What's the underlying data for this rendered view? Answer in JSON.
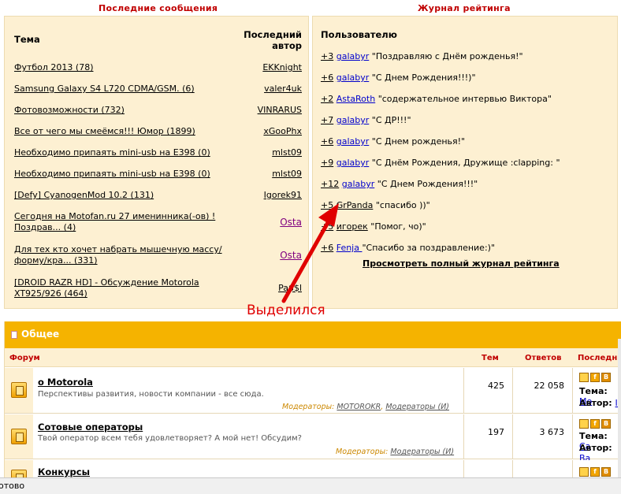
{
  "sections": {
    "recent_title": "Последние сообщения",
    "rating_title": "Журнал рейтинга"
  },
  "recent": {
    "col_topic": "Тема",
    "col_author": "Последний автор",
    "rows": [
      {
        "topic": "Футбол 2013 (78)",
        "author": "EKKnight"
      },
      {
        "topic": "Samsung Galaxy S4 L720 CDMA/GSM. (6)",
        "author": "valer4uk"
      },
      {
        "topic": "Фотовозможности (732)",
        "author": "VINRARUS"
      },
      {
        "topic": "Все от чего мы смеёмся!!! Юмор (1899)",
        "author": "xGooPhx"
      },
      {
        "topic": "Необходимо припаять mini-usb на E398 (0)",
        "author": "mlst09"
      },
      {
        "topic": "Необходимо припаять mini-usb на E398 (0)",
        "author": "mlst09"
      },
      {
        "topic": "[Defy] CyanogenMod 10.2 (131)",
        "author": "Igorek91"
      },
      {
        "topic": "Сегодня на Motofan.ru 27 именинника(-ов) ! Поздрав... (4)",
        "author": "Osta"
      },
      {
        "topic": "Для тех кто хочет набрать мышечную массу/форму/кра... (331)",
        "author": "Osta"
      },
      {
        "topic": "[DROID RAZR HD] - Обсуждение Motorola XT925/926 (464)",
        "author": "Pa$$l"
      }
    ]
  },
  "rating": {
    "header": "Пользователю",
    "rows": [
      {
        "points": "+3",
        "user": "galabyr",
        "msg": "\"Поздравляю с Днём рожденья!\""
      },
      {
        "points": "+6",
        "user": "galabyr",
        "msg": "\"С Днем Рождения!!!)\""
      },
      {
        "points": "+2",
        "user": "AstaRoth",
        "msg": "\"содержательное интервью Виктора\""
      },
      {
        "points": "+7",
        "user": "galabyr",
        "msg": "\"С ДР!!!\""
      },
      {
        "points": "+6",
        "user": "galabyr",
        "msg": "\"С Днем рожденья!\""
      },
      {
        "points": "+9",
        "user": "galabyr",
        "msg": "\"С Днём Рождения, Дружище :clapping: \""
      },
      {
        "points": "+12",
        "user": "galabyr",
        "msg": "\"С Днем Рождения!!!\""
      },
      {
        "points": "+5",
        "user": "GrPanda",
        "msg": "\"спасибо ))\""
      },
      {
        "points": "+5",
        "user": "игорек",
        "msg": "\"Помог, чо)\""
      },
      {
        "points": "+6",
        "user": "Fenja ",
        "msg": "\"Спасибо за поздравление:)\""
      }
    ],
    "full_log_link": "Просмотреть полный журнал рейтинга"
  },
  "annotation": {
    "text": "Выделился",
    "color": "#e00000"
  },
  "forum": {
    "category": "Общее",
    "col_forum": "Форум",
    "col_topics": "Тем",
    "col_replies": "Ответов",
    "col_last": "Последн",
    "rows": [
      {
        "name": "о Motorola",
        "desc": "Перспективы развития, новости компании - все сюда.",
        "mods_label": "Модераторы:",
        "mods": [
          "MOTOROKR",
          "Модераторы (И)"
        ],
        "topics": "425",
        "replies": "22 058",
        "theme_label": "Тема:",
        "theme_value": "Mo",
        "author_label": "Автор:",
        "author_value": "Il"
      },
      {
        "name": "Сотовые операторы",
        "desc": "Твой оператор всем тебя удовлетворяет? А мой нет! Обсудим?",
        "mods_label": "Модераторы:",
        "mods": [
          "Модераторы (И)"
        ],
        "topics": "197",
        "replies": "3 673",
        "theme_label": "Тема:",
        "theme_value": "Са",
        "author_label": "Автор:",
        "author_value": "Ва"
      },
      {
        "name": "Конкурсы"
      }
    ]
  },
  "status": {
    "text": "отово"
  },
  "colors": {
    "panel_bg": "#fdf0d2",
    "section_title": "#c00000",
    "category_bar": "#f5b300",
    "link_blue": "#0000cc"
  }
}
